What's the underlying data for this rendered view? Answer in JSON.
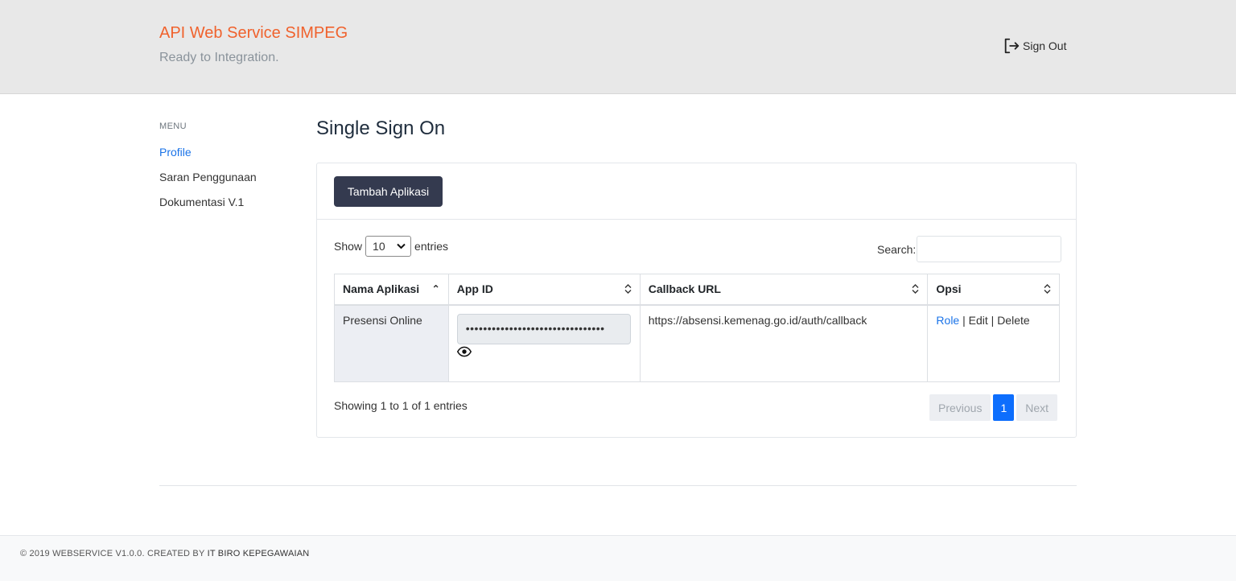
{
  "header": {
    "title": "API Web Service SIMPEG",
    "subtitle": "Ready to Integration.",
    "signout_label": "Sign Out",
    "title_color": "#f0622d"
  },
  "sidebar": {
    "label": "MENU",
    "items": [
      {
        "label": "Profile",
        "active": true
      },
      {
        "label": "Saran Penggunaan",
        "active": false
      },
      {
        "label": "Dokumentasi V.1",
        "active": false
      }
    ]
  },
  "main": {
    "title": "Single Sign On",
    "add_button": "Tambah Aplikasi",
    "length": {
      "prefix": "Show",
      "value": "10",
      "suffix": "entries"
    },
    "search": {
      "label": "Search:",
      "value": ""
    },
    "table": {
      "columns": [
        "Nama Aplikasi",
        "App ID",
        "Callback URL",
        "Opsi"
      ],
      "rows": [
        {
          "name": "Presensi Online",
          "app_id_masked": "••••••••••••••••••••••••••••••••",
          "callback": "https://absensi.kemenag.go.id/auth/callback",
          "actions": {
            "role": "Role",
            "sep1": " | ",
            "edit": "Edit",
            "sep2": " | ",
            "delete": "Delete"
          }
        }
      ]
    },
    "info": "Showing 1 to 1 of 1 entries",
    "pagination": {
      "previous": "Previous",
      "current": "1",
      "next": "Next"
    }
  },
  "footer": {
    "text": "© 2019 WEBSERVICE V1.0.0. CREATED BY",
    "author": "IT BIRO KEPEGAWAIAN"
  },
  "icons": [
    "sign-out-icon",
    "chevron-down-icon",
    "sort-asc-icon",
    "sort-icon",
    "eye-icon"
  ]
}
